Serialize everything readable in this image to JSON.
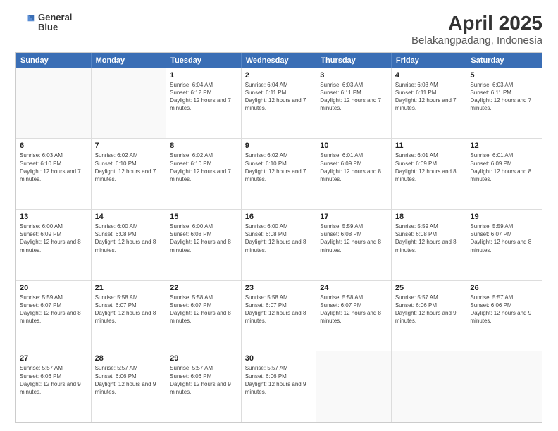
{
  "logo": {
    "line1": "General",
    "line2": "Blue"
  },
  "title": "April 2025",
  "subtitle": "Belakangpadang, Indonesia",
  "weekdays": [
    "Sunday",
    "Monday",
    "Tuesday",
    "Wednesday",
    "Thursday",
    "Friday",
    "Saturday"
  ],
  "rows": [
    [
      {
        "day": "",
        "text": ""
      },
      {
        "day": "",
        "text": ""
      },
      {
        "day": "1",
        "text": "Sunrise: 6:04 AM\nSunset: 6:12 PM\nDaylight: 12 hours and 7 minutes."
      },
      {
        "day": "2",
        "text": "Sunrise: 6:04 AM\nSunset: 6:11 PM\nDaylight: 12 hours and 7 minutes."
      },
      {
        "day": "3",
        "text": "Sunrise: 6:03 AM\nSunset: 6:11 PM\nDaylight: 12 hours and 7 minutes."
      },
      {
        "day": "4",
        "text": "Sunrise: 6:03 AM\nSunset: 6:11 PM\nDaylight: 12 hours and 7 minutes."
      },
      {
        "day": "5",
        "text": "Sunrise: 6:03 AM\nSunset: 6:11 PM\nDaylight: 12 hours and 7 minutes."
      }
    ],
    [
      {
        "day": "6",
        "text": "Sunrise: 6:03 AM\nSunset: 6:10 PM\nDaylight: 12 hours and 7 minutes."
      },
      {
        "day": "7",
        "text": "Sunrise: 6:02 AM\nSunset: 6:10 PM\nDaylight: 12 hours and 7 minutes."
      },
      {
        "day": "8",
        "text": "Sunrise: 6:02 AM\nSunset: 6:10 PM\nDaylight: 12 hours and 7 minutes."
      },
      {
        "day": "9",
        "text": "Sunrise: 6:02 AM\nSunset: 6:10 PM\nDaylight: 12 hours and 7 minutes."
      },
      {
        "day": "10",
        "text": "Sunrise: 6:01 AM\nSunset: 6:09 PM\nDaylight: 12 hours and 8 minutes."
      },
      {
        "day": "11",
        "text": "Sunrise: 6:01 AM\nSunset: 6:09 PM\nDaylight: 12 hours and 8 minutes."
      },
      {
        "day": "12",
        "text": "Sunrise: 6:01 AM\nSunset: 6:09 PM\nDaylight: 12 hours and 8 minutes."
      }
    ],
    [
      {
        "day": "13",
        "text": "Sunrise: 6:00 AM\nSunset: 6:09 PM\nDaylight: 12 hours and 8 minutes."
      },
      {
        "day": "14",
        "text": "Sunrise: 6:00 AM\nSunset: 6:08 PM\nDaylight: 12 hours and 8 minutes."
      },
      {
        "day": "15",
        "text": "Sunrise: 6:00 AM\nSunset: 6:08 PM\nDaylight: 12 hours and 8 minutes."
      },
      {
        "day": "16",
        "text": "Sunrise: 6:00 AM\nSunset: 6:08 PM\nDaylight: 12 hours and 8 minutes."
      },
      {
        "day": "17",
        "text": "Sunrise: 5:59 AM\nSunset: 6:08 PM\nDaylight: 12 hours and 8 minutes."
      },
      {
        "day": "18",
        "text": "Sunrise: 5:59 AM\nSunset: 6:08 PM\nDaylight: 12 hours and 8 minutes."
      },
      {
        "day": "19",
        "text": "Sunrise: 5:59 AM\nSunset: 6:07 PM\nDaylight: 12 hours and 8 minutes."
      }
    ],
    [
      {
        "day": "20",
        "text": "Sunrise: 5:59 AM\nSunset: 6:07 PM\nDaylight: 12 hours and 8 minutes."
      },
      {
        "day": "21",
        "text": "Sunrise: 5:58 AM\nSunset: 6:07 PM\nDaylight: 12 hours and 8 minutes."
      },
      {
        "day": "22",
        "text": "Sunrise: 5:58 AM\nSunset: 6:07 PM\nDaylight: 12 hours and 8 minutes."
      },
      {
        "day": "23",
        "text": "Sunrise: 5:58 AM\nSunset: 6:07 PM\nDaylight: 12 hours and 8 minutes."
      },
      {
        "day": "24",
        "text": "Sunrise: 5:58 AM\nSunset: 6:07 PM\nDaylight: 12 hours and 8 minutes."
      },
      {
        "day": "25",
        "text": "Sunrise: 5:57 AM\nSunset: 6:06 PM\nDaylight: 12 hours and 9 minutes."
      },
      {
        "day": "26",
        "text": "Sunrise: 5:57 AM\nSunset: 6:06 PM\nDaylight: 12 hours and 9 minutes."
      }
    ],
    [
      {
        "day": "27",
        "text": "Sunrise: 5:57 AM\nSunset: 6:06 PM\nDaylight: 12 hours and 9 minutes."
      },
      {
        "day": "28",
        "text": "Sunrise: 5:57 AM\nSunset: 6:06 PM\nDaylight: 12 hours and 9 minutes."
      },
      {
        "day": "29",
        "text": "Sunrise: 5:57 AM\nSunset: 6:06 PM\nDaylight: 12 hours and 9 minutes."
      },
      {
        "day": "30",
        "text": "Sunrise: 5:57 AM\nSunset: 6:06 PM\nDaylight: 12 hours and 9 minutes."
      },
      {
        "day": "",
        "text": ""
      },
      {
        "day": "",
        "text": ""
      },
      {
        "day": "",
        "text": ""
      }
    ]
  ]
}
